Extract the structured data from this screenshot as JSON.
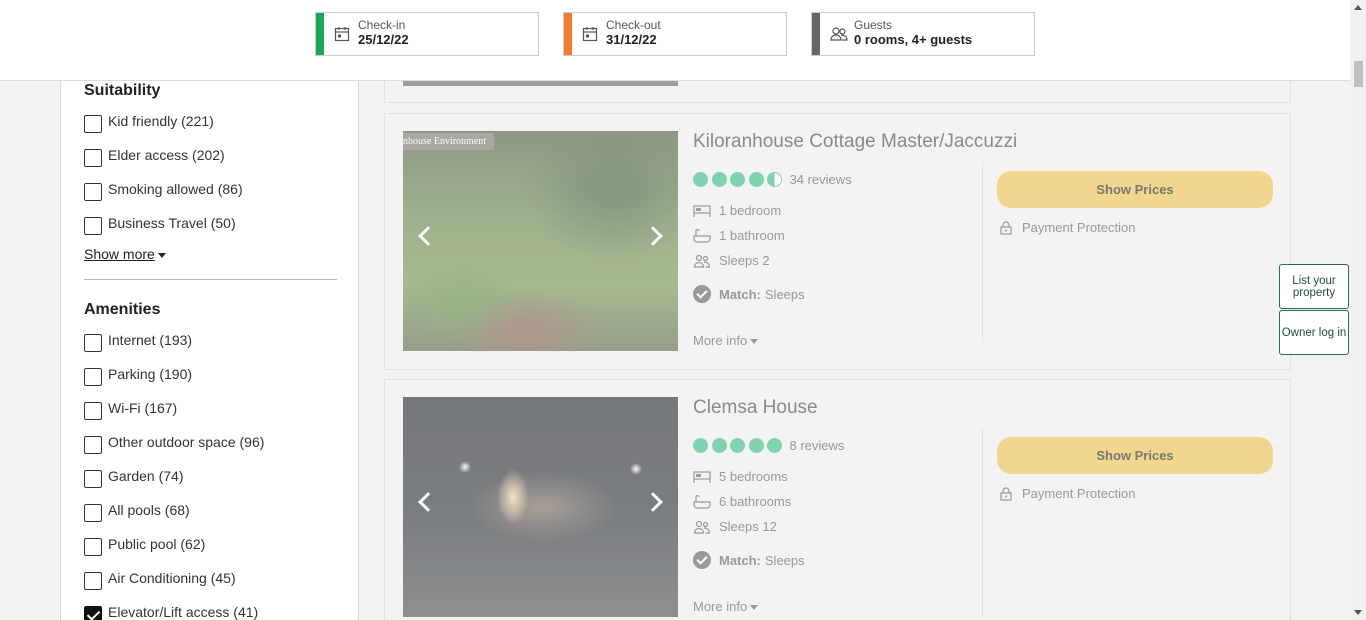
{
  "search": {
    "checkin": {
      "label": "Check-in",
      "value": "25/12/22",
      "color": "#17a85a"
    },
    "checkout": {
      "label": "Check-out",
      "value": "31/12/22",
      "color": "#f47c2a"
    },
    "guests": {
      "label": "Guests",
      "value": "0 rooms, 4+ guests",
      "color": "#666666"
    }
  },
  "sidebar": {
    "suitability_title": "Suitability",
    "suitability": [
      {
        "label": "Kid friendly (221)",
        "checked": false
      },
      {
        "label": "Elder access (202)",
        "checked": false
      },
      {
        "label": "Smoking allowed (86)",
        "checked": false
      },
      {
        "label": "Business Travel (50)",
        "checked": false
      }
    ],
    "show_more": "Show more",
    "amenities_title": "Amenities",
    "amenities": [
      {
        "label": "Internet (193)",
        "checked": false
      },
      {
        "label": "Parking (190)",
        "checked": false
      },
      {
        "label": "Wi-Fi (167)",
        "checked": false
      },
      {
        "label": "Other outdoor space (96)",
        "checked": false
      },
      {
        "label": "Garden (74)",
        "checked": false
      },
      {
        "label": "All pools (68)",
        "checked": false
      },
      {
        "label": "Public pool (62)",
        "checked": false
      },
      {
        "label": "Air Conditioning (45)",
        "checked": false
      },
      {
        "label": "Elevator/Lift access (41)",
        "checked": true
      }
    ]
  },
  "listings": [
    {
      "title": "Kiloranhouse Cottage Master/Jaccuzzi",
      "photo_caption": "nhouse Environment",
      "rating": 4.5,
      "reviews": "34 reviews",
      "bedrooms": "1 bedroom",
      "bathrooms": "1 bathroom",
      "sleeps": "Sleeps 2",
      "match_label": "Match:",
      "match_value": "Sleeps",
      "more_info": "More info",
      "price_button": "Show Prices",
      "protection": "Payment Protection"
    },
    {
      "title": "Clemsa House",
      "rating": 5,
      "reviews": "8 reviews",
      "bedrooms": "5 bedrooms",
      "bathrooms": "6 bathrooms",
      "sleeps": "Sleeps 12",
      "match_label": "Match:",
      "match_value": "Sleeps",
      "more_info": "More info",
      "price_button": "Show Prices",
      "protection": "Payment Protection"
    }
  ],
  "floating": {
    "list_property": "List your property",
    "owner_login": "Owner log in"
  }
}
